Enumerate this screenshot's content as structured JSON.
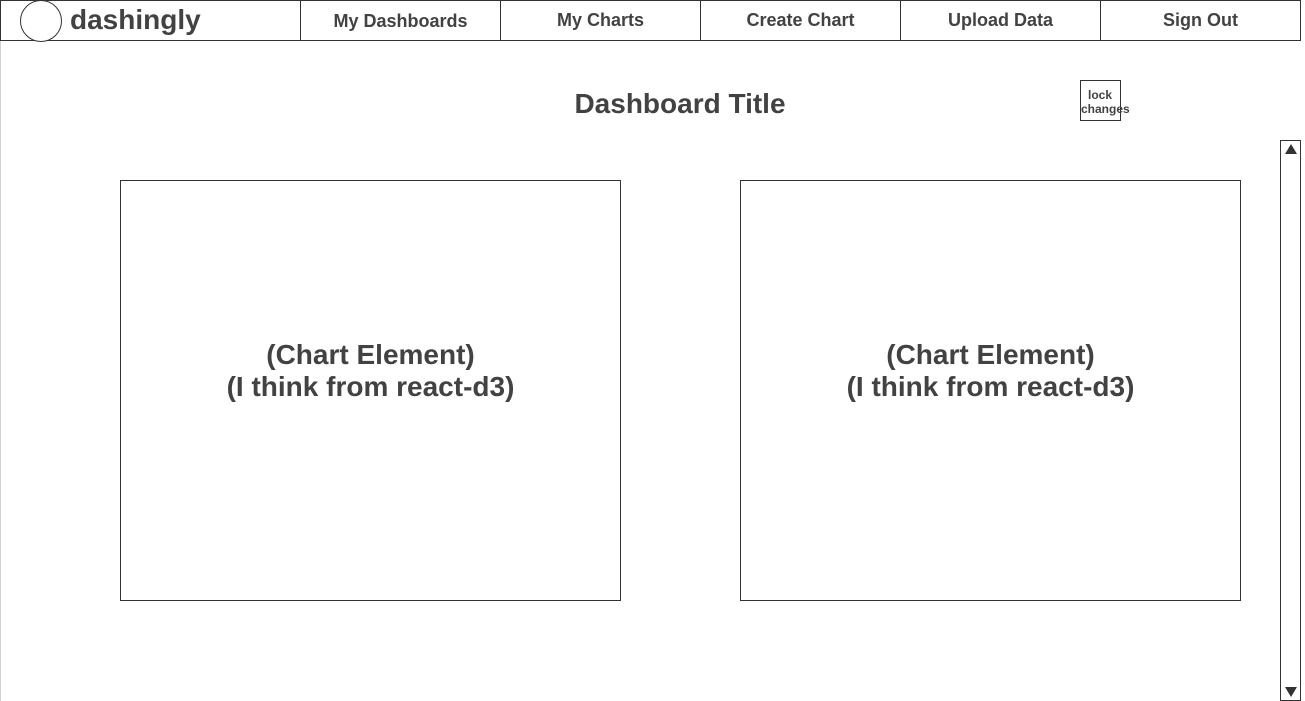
{
  "brand": {
    "name": "dashingly",
    "logo_icon": "circle-logo-icon"
  },
  "nav": {
    "items": [
      {
        "label": "My Dashboards"
      },
      {
        "label": "My Charts"
      },
      {
        "label": "Create Chart"
      },
      {
        "label": "Upload Data"
      },
      {
        "label": "Sign Out"
      }
    ]
  },
  "dashboard": {
    "title": "Dashboard Title",
    "lock_button": {
      "line1": "lock",
      "line2": "changes"
    }
  },
  "charts": [
    {
      "line1": "(Chart Element)",
      "line2": "(I think from react-d3)"
    },
    {
      "line1": "(Chart Element)",
      "line2": "(I think from react-d3)"
    }
  ],
  "scrollbar": {
    "up_icon": "arrow-up-icon",
    "down_icon": "arrow-down-icon"
  },
  "colors": {
    "border": "#333333",
    "text": "#424242",
    "background": "#ffffff"
  }
}
